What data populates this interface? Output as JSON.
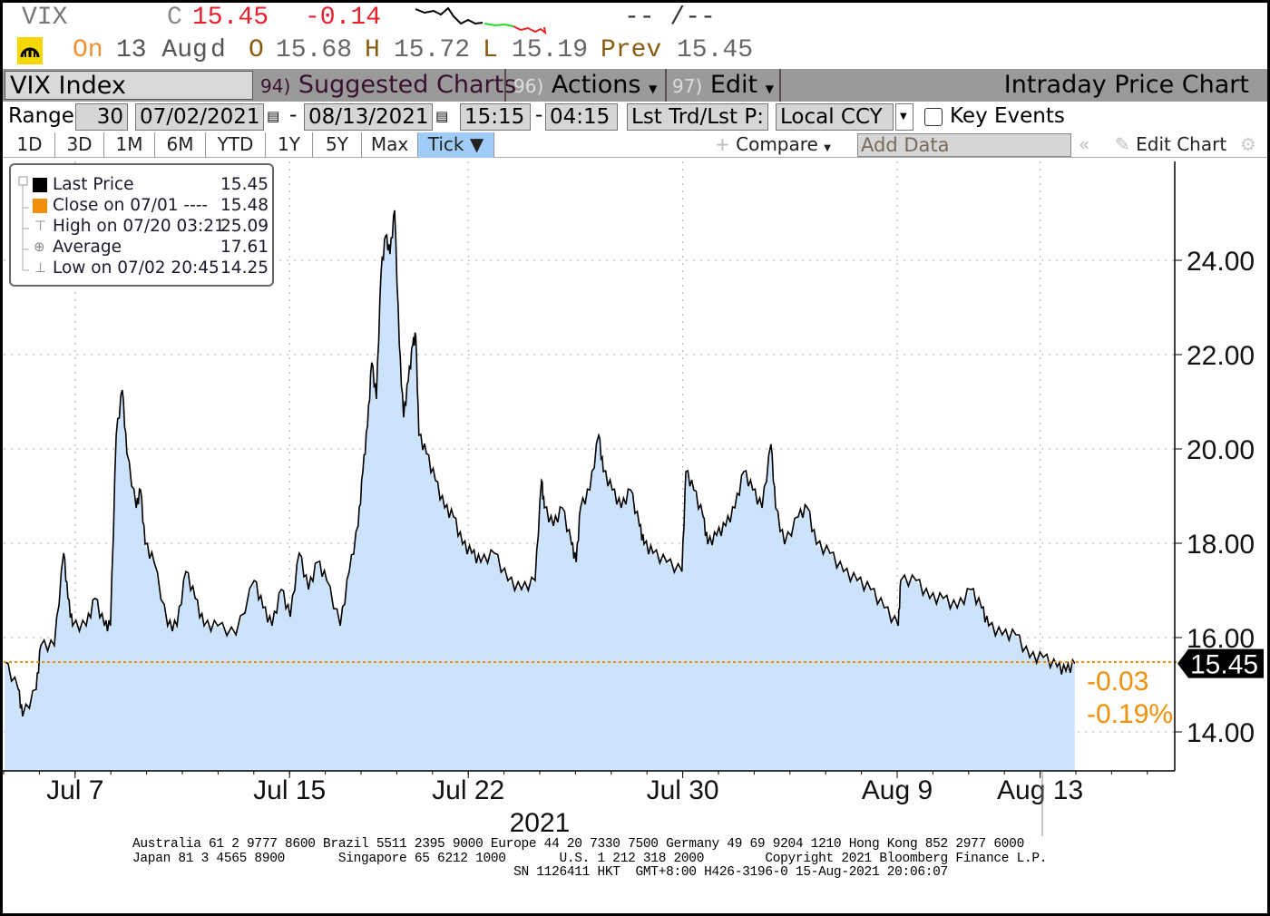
{
  "header": {
    "ticker": "VIX",
    "close_prefix": "C",
    "close": "15.45",
    "change": "-0.14",
    "bid_ask": "-- /--",
    "on_label": "On",
    "date": "13 Aug",
    "d_label": "d",
    "open_label": "O",
    "open": "15.68",
    "high_label": "H",
    "high": "15.72",
    "low_label": "L",
    "low": "15.19",
    "prev_label": "Prev",
    "prev": "15.45"
  },
  "toolbar": {
    "security": "VIX Index",
    "suggested_num": "94)",
    "suggested": "Suggested Charts",
    "actions_num": "96)",
    "actions": "Actions",
    "edit_num": "97)",
    "edit": "Edit",
    "title": "Intraday Price Chart"
  },
  "range_row": {
    "range_label": "Range",
    "range_value": "30",
    "start_date": "07/02/2021",
    "end_date": "08/13/2021",
    "start_time": "15:15",
    "end_time": "04:15",
    "price_type": "Lst Trd/Lst P:",
    "currency": "Local CCY",
    "key_events": "Key Events"
  },
  "periods": [
    "1D",
    "3D",
    "1M",
    "6M",
    "YTD",
    "1Y",
    "5Y",
    "Max",
    "Tick ▼"
  ],
  "chart_tools": {
    "compare": "Compare",
    "add_data": "Add Data",
    "edit_chart": "Edit Chart"
  },
  "legend": [
    {
      "label": "Last Price",
      "value": "15.45",
      "color": "#000000"
    },
    {
      "label": "Close on 07/01 ----",
      "value": "15.48",
      "color": "#f0900a"
    },
    {
      "label": "High on 07/20 03:21",
      "value": "25.09"
    },
    {
      "label": "Average",
      "value": "17.61"
    },
    {
      "label": "Low on 07/02 20:45",
      "value": "14.25"
    }
  ],
  "chart_data": {
    "type": "area",
    "title": "VIX Index Intraday Price Chart",
    "xlabel": "2021",
    "ylabel": "",
    "ylim": [
      13.17,
      26.1
    ],
    "xlim": [
      0,
      32.75
    ],
    "y_ticks": [
      "14.00",
      "16.00",
      "18.00",
      "20.00",
      "22.00",
      "24.00"
    ],
    "x_ticks": [
      {
        "label": "Jul 7",
        "session": 2
      },
      {
        "label": "Jul 15",
        "session": 8
      },
      {
        "label": "Jul 22",
        "session": 13
      },
      {
        "label": "Jul 30",
        "session": 19
      },
      {
        "label": "Aug 9",
        "session": 25
      },
      {
        "label": "Aug 13",
        "session": 29
      }
    ],
    "last_price_label": "15.45",
    "last_price": 15.45,
    "reference_close": 15.48,
    "change_abs": "-0.03",
    "change_pct": "-0.19%",
    "series": [
      {
        "name": "Last Price",
        "color": "#000000",
        "fill": "#cce3fb",
        "points": [
          [
            0.03,
            15.48
          ],
          [
            0.41,
            14.9
          ],
          [
            0.53,
            14.33
          ],
          [
            0.91,
            14.9
          ],
          [
            1.04,
            15.83
          ],
          [
            1.42,
            15.83
          ],
          [
            1.68,
            17.79
          ],
          [
            1.8,
            16.83
          ],
          [
            1.93,
            16.25
          ],
          [
            2.31,
            16.25
          ],
          [
            2.56,
            16.83
          ],
          [
            2.82,
            16.25
          ],
          [
            2.99,
            16.25
          ],
          [
            3.15,
            20.29
          ],
          [
            3.32,
            21.25
          ],
          [
            3.45,
            19.9
          ],
          [
            3.71,
            18.75
          ],
          [
            3.83,
            19.13
          ],
          [
            3.96,
            17.98
          ],
          [
            4.21,
            17.6
          ],
          [
            4.59,
            16.25
          ],
          [
            4.85,
            16.25
          ],
          [
            5.1,
            17.4
          ],
          [
            5.36,
            16.83
          ],
          [
            5.61,
            16.25
          ],
          [
            5.99,
            16.25
          ],
          [
            6.5,
            16.06
          ],
          [
            7.01,
            17.21
          ],
          [
            7.26,
            16.63
          ],
          [
            7.51,
            16.25
          ],
          [
            7.77,
            17.02
          ],
          [
            8.02,
            16.44
          ],
          [
            8.27,
            17.79
          ],
          [
            8.53,
            17.02
          ],
          [
            8.78,
            17.6
          ],
          [
            9.04,
            17.21
          ],
          [
            9.42,
            16.25
          ],
          [
            9.67,
            17.4
          ],
          [
            9.92,
            18.37
          ],
          [
            10.05,
            19.52
          ],
          [
            10.18,
            20.48
          ],
          [
            10.3,
            21.83
          ],
          [
            10.43,
            21.06
          ],
          [
            10.56,
            23.75
          ],
          [
            10.69,
            24.52
          ],
          [
            10.81,
            24.13
          ],
          [
            10.94,
            25.06
          ],
          [
            11.07,
            22.21
          ],
          [
            11.19,
            20.67
          ],
          [
            11.32,
            21.44
          ],
          [
            11.45,
            22.21
          ],
          [
            11.53,
            22.4
          ],
          [
            11.62,
            20.29
          ],
          [
            11.83,
            19.9
          ],
          [
            12.08,
            19.33
          ],
          [
            12.34,
            18.75
          ],
          [
            12.59,
            18.56
          ],
          [
            12.84,
            17.98
          ],
          [
            13.1,
            17.79
          ],
          [
            13.35,
            17.6
          ],
          [
            13.73,
            17.79
          ],
          [
            14.11,
            17.21
          ],
          [
            14.49,
            17.02
          ],
          [
            14.87,
            17.21
          ],
          [
            15.05,
            19.33
          ],
          [
            15.13,
            18.75
          ],
          [
            15.38,
            18.37
          ],
          [
            15.63,
            18.75
          ],
          [
            15.89,
            17.98
          ],
          [
            16.02,
            17.6
          ],
          [
            16.14,
            18.75
          ],
          [
            16.4,
            19.13
          ],
          [
            16.65,
            20.29
          ],
          [
            16.78,
            19.52
          ],
          [
            17.03,
            19.13
          ],
          [
            17.28,
            18.75
          ],
          [
            17.54,
            19.13
          ],
          [
            17.79,
            18.37
          ],
          [
            17.92,
            17.98
          ],
          [
            18.17,
            17.79
          ],
          [
            18.55,
            17.6
          ],
          [
            18.98,
            17.4
          ],
          [
            19.09,
            19.52
          ],
          [
            19.31,
            19.13
          ],
          [
            19.57,
            18.56
          ],
          [
            19.7,
            17.98
          ],
          [
            19.95,
            18.17
          ],
          [
            20.2,
            18.37
          ],
          [
            20.46,
            18.75
          ],
          [
            20.71,
            19.52
          ],
          [
            20.96,
            19.13
          ],
          [
            21.22,
            18.75
          ],
          [
            21.47,
            20.1
          ],
          [
            21.6,
            18.75
          ],
          [
            21.85,
            17.98
          ],
          [
            22.23,
            18.56
          ],
          [
            22.49,
            18.75
          ],
          [
            22.74,
            17.98
          ],
          [
            23.12,
            17.79
          ],
          [
            23.5,
            17.4
          ],
          [
            23.88,
            17.21
          ],
          [
            24.26,
            17.02
          ],
          [
            24.64,
            16.63
          ],
          [
            25.03,
            16.25
          ],
          [
            25.1,
            17.21
          ],
          [
            25.53,
            17.21
          ],
          [
            25.91,
            16.83
          ],
          [
            26.29,
            16.83
          ],
          [
            26.68,
            16.63
          ],
          [
            27.06,
            17.02
          ],
          [
            27.36,
            16.63
          ],
          [
            27.56,
            16.25
          ],
          [
            27.94,
            16.06
          ],
          [
            28.32,
            16.06
          ],
          [
            28.71,
            15.58
          ],
          [
            29.09,
            15.58
          ],
          [
            29.48,
            15.38
          ],
          [
            29.72,
            15.29
          ],
          [
            29.97,
            15.45
          ]
        ]
      }
    ]
  },
  "footer": {
    "line1": "Australia 61 2 9777 8600 Brazil 5511 2395 9000 Europe 44 20 7330 7500 Germany 49 69 9204 1210 Hong Kong 852 2977 6000",
    "line2": "Japan 81 3 4565 8900       Singapore 65 6212 1000       U.S. 1 212 318 2000        Copyright 2021 Bloomberg Finance L.P.",
    "line3": "                                                  SN 1126411 HKT  GMT+8:00 H426-3196-0 15-Aug-2021 20:06:07"
  }
}
